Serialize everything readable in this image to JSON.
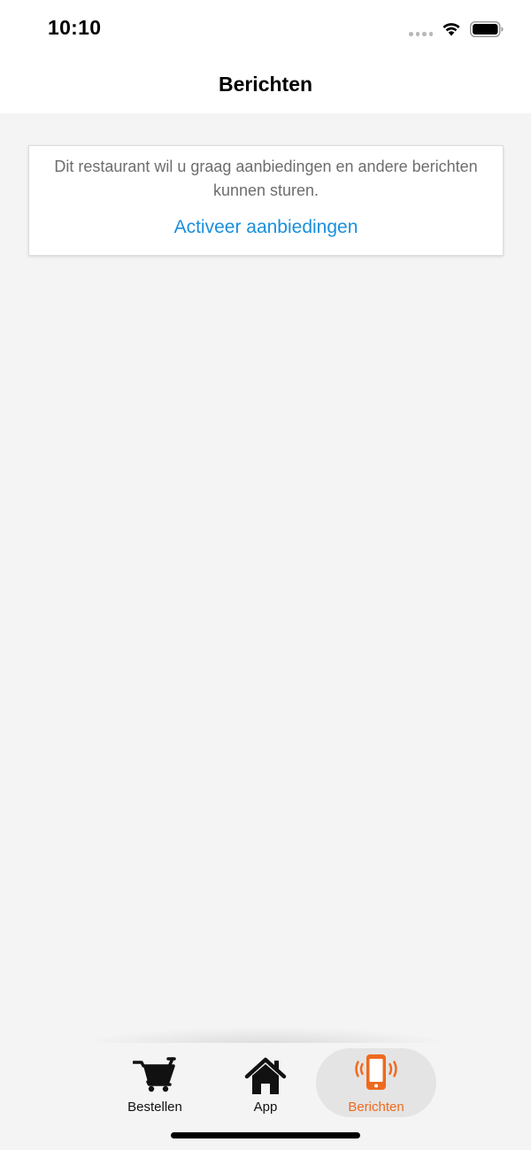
{
  "status_bar": {
    "time": "10:10",
    "icons": [
      "signal-dots-icon",
      "wifi-icon",
      "battery-icon"
    ]
  },
  "header": {
    "title": "Berichten"
  },
  "promo": {
    "message": "Dit restaurant wil u graag aanbiedingen en andere berichten kunnen sturen.",
    "action_label": "Activeer aanbiedingen"
  },
  "tabs": [
    {
      "label": "Bestellen",
      "icon": "cart-icon",
      "active": false
    },
    {
      "label": "App",
      "icon": "home-icon",
      "active": false
    },
    {
      "label": "Berichten",
      "icon": "phone-vibrate-icon",
      "active": true
    }
  ],
  "colors": {
    "accent": "#ee6a1e",
    "link": "#1a8fdc",
    "background": "#f4f4f4",
    "active_tab_bg": "#e4e4e4",
    "message_text": "#6d6d6d"
  }
}
